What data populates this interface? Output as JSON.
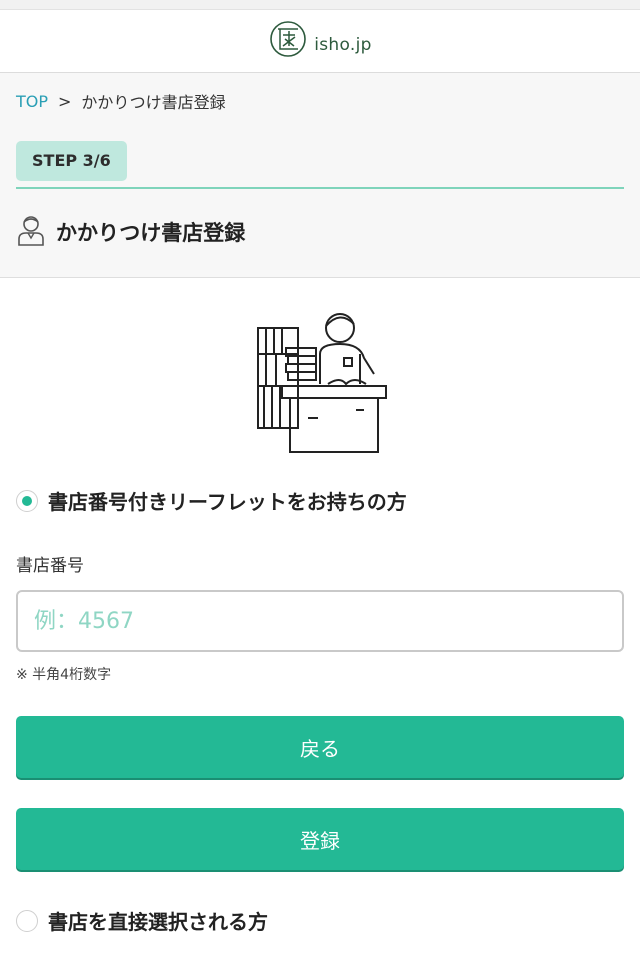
{
  "header": {
    "logo_text": "isho.jp",
    "logo_icon": "isho-logo-icon"
  },
  "breadcrumb": {
    "home": "TOP",
    "separator": ">",
    "current": "かかりつけ書店登録"
  },
  "step": {
    "label": "STEP 3/6"
  },
  "page": {
    "title": "かかりつけ書店登録",
    "title_icon": "user-icon"
  },
  "illustration": {
    "icon": "bookstore-clerk-illustration"
  },
  "option_leaflet": {
    "label": "書店番号付きリーフレットをお持ちの方",
    "selected": true
  },
  "shop_number": {
    "label": "書店番号",
    "value": "",
    "placeholder": "例：4567",
    "hint": "※ 半角4桁数字"
  },
  "buttons": {
    "back": "戻る",
    "register": "登録"
  },
  "option_direct": {
    "label": "書店を直接選択される方",
    "selected": false
  },
  "colors": {
    "accent": "#23b995",
    "link": "#2a9fb5",
    "badge_bg": "#bfe8de",
    "rule": "#7fd4bb"
  }
}
